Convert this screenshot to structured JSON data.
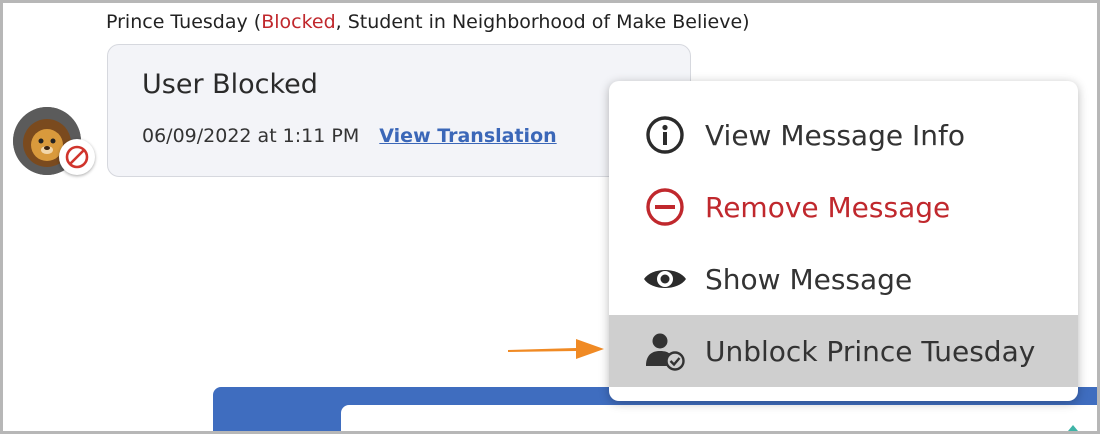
{
  "header": {
    "sender_name": "Prince Tuesday",
    "status": "Blocked",
    "role_text": ", Student in Neighborhood of Make Believe)"
  },
  "message": {
    "title": "User Blocked",
    "timestamp": "06/09/2022 at 1:11 PM",
    "translation_link": "View Translation"
  },
  "context_menu": {
    "items": [
      {
        "label": "View Message Info",
        "icon": "info-icon"
      },
      {
        "label": "Remove Message",
        "icon": "minus-circle-icon"
      },
      {
        "label": "Show Message",
        "icon": "eye-icon"
      },
      {
        "label": "Unblock Prince Tuesday",
        "icon": "user-check-icon"
      }
    ]
  },
  "colors": {
    "accent_blue": "#3f6dbf",
    "danger_red": "#c0282d",
    "arrow_orange": "#f08a24",
    "highlight_gray": "#cfcfcf"
  }
}
